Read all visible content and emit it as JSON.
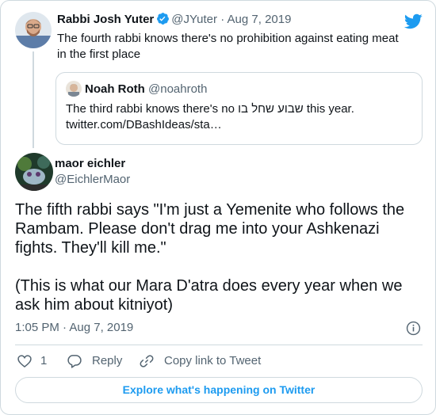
{
  "colors": {
    "accent": "#1d9bf0",
    "text_primary": "#0f1419",
    "text_secondary": "#536471",
    "border": "#cfd9de"
  },
  "parent_tweet": {
    "display_name": "Rabbi Josh Yuter",
    "handle": "@JYuter",
    "separator": "·",
    "date": "Aug 7, 2019",
    "text": "The fourth rabbi knows there's no prohibition against eating meat in the first place",
    "verified_icon": "verified-badge-icon",
    "quoted_tweet": {
      "display_name": "Noah Roth",
      "handle": "@noahroth",
      "text_before": "The third rabbi knows there's no ",
      "text_hebrew": "שבוע שחל בו",
      "text_after": " this year.",
      "link": "twitter.com/DBashIdeas/sta…"
    }
  },
  "main_tweet": {
    "display_name": "maor eichler",
    "handle": "@EichlerMaor",
    "text": "The fifth rabbi says \"I'm just a Yemenite who follows the Rambam. Please don't drag me into your Ashkenazi fights. They'll kill me.\"\n\n(This is what our Mara D'atra does every year when we ask him about kitniyot)",
    "timestamp": "1:05 PM · Aug 7, 2019"
  },
  "actions": {
    "like_count": "1",
    "reply_label": "Reply",
    "copy_link_label": "Copy link to Tweet"
  },
  "footer": {
    "explore_label": "Explore what's happening on Twitter"
  },
  "icons": [
    "twitter-bird-icon",
    "verified-badge-icon",
    "info-icon",
    "heart-icon",
    "reply-bubble-icon",
    "link-icon"
  ]
}
